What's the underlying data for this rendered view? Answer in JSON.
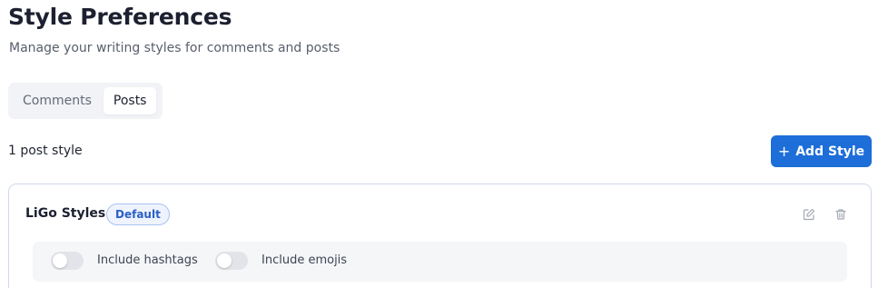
{
  "header": {
    "title": "Style Preferences",
    "subtitle": "Manage your writing styles for comments and posts"
  },
  "tabs": [
    {
      "label": "Comments",
      "active": false
    },
    {
      "label": "Posts",
      "active": true
    }
  ],
  "toolbar": {
    "count_label": "1 post style",
    "add_button_label": "Add Style",
    "add_button_icon": "plus-icon"
  },
  "styles": [
    {
      "name": "LiGo Styles",
      "badge": "Default",
      "actions": [
        "edit-icon",
        "trash-icon"
      ],
      "options": [
        {
          "label": "Include hashtags",
          "enabled": false
        },
        {
          "label": "Include emojis",
          "enabled": false
        }
      ]
    }
  ],
  "colors": {
    "accent": "#1d6ed8",
    "badge_text": "#2b5fc6",
    "card_border": "#cfd8ea"
  }
}
